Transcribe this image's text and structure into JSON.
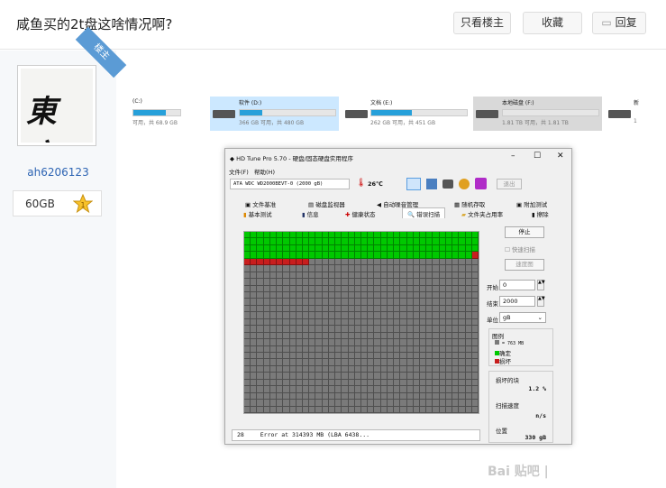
{
  "header": {
    "title": "咸鱼买的2t盘这啥情况啊?",
    "only_op": "只看楼主",
    "favorite": "收藏",
    "reply": "回复"
  },
  "user": {
    "badge": "楼主",
    "avatar_text": "東方",
    "name": "ah6206123",
    "level": "60GB",
    "star_level": "1"
  },
  "drives": [
    {
      "name": "(C:)",
      "info": "可用，共 68.9 GB",
      "fill": 0.7
    },
    {
      "name": "软件 (D:)",
      "info": "366 GB 可用，共 480 GB",
      "fill": 0.24
    },
    {
      "name": "文档 (E:)",
      "info": "262 GB 可用，共 451 GB",
      "fill": 0.42
    },
    {
      "name": "本地磁盘 (F:)",
      "info": "1.81 TB 可用，共 1.81 TB",
      "fill": 0.0
    },
    {
      "name": "新",
      "info": "1"
    }
  ],
  "window": {
    "title": "HD Tune Pro 5.70 - 硬盘/固态硬盘实用程序",
    "minimize": "–",
    "maximize": "☐",
    "close": "✕",
    "menu": [
      "文件(F)",
      "帮助(H)"
    ],
    "drive_select": "ATA    WDC WD2000BEVT-0 (2000 gB)",
    "temperature": "26℃",
    "exit": "退出",
    "tabs_row1": [
      "文件基准",
      "磁盘监视器",
      "自动噪音管理",
      "随机存取",
      "附加测试"
    ],
    "tabs_row2": [
      "基本测试",
      "信息",
      "健康状态",
      "错误扫描",
      "文件夹占用率",
      "擦除"
    ],
    "stop": "停止",
    "quick_scan": "快速扫描",
    "speed_map": "速度图",
    "start_label": "开始",
    "start_value": "0",
    "end_label": "结束",
    "end_value": "2000",
    "unit_label": "单位",
    "unit_value": "gB",
    "legend_title": "图例",
    "legend_size": "= 763 MB",
    "legend_ok": "确定",
    "legend_bad": "损坏",
    "damaged_label": "损坏的块",
    "damaged_value": "1.2 %",
    "scan_speed_label": "扫描速度",
    "scan_speed_value": "n/s",
    "position_label": "位置",
    "position_value": "330 gB",
    "status_count": "28",
    "status_msg": "Error at 314393 MB (LBA 6438..."
  },
  "scan": {
    "cols": 36,
    "rows": 27,
    "green_rows": 4,
    "green_extra_cols": 10,
    "red_cells": [
      [
        4,
        0
      ],
      [
        4,
        1
      ],
      [
        4,
        2
      ],
      [
        4,
        3
      ],
      [
        4,
        4
      ],
      [
        4,
        5
      ],
      [
        4,
        6
      ],
      [
        4,
        7
      ],
      [
        4,
        8
      ],
      [
        4,
        9
      ],
      [
        3,
        35
      ]
    ]
  },
  "watermark": "Bai  贴吧 |",
  "colors": {
    "ok": "#00c800",
    "bad": "#c81e1e",
    "unscanned": "#7a7a7a",
    "link": "#2d64b3",
    "badge": "#5b9bd5"
  }
}
